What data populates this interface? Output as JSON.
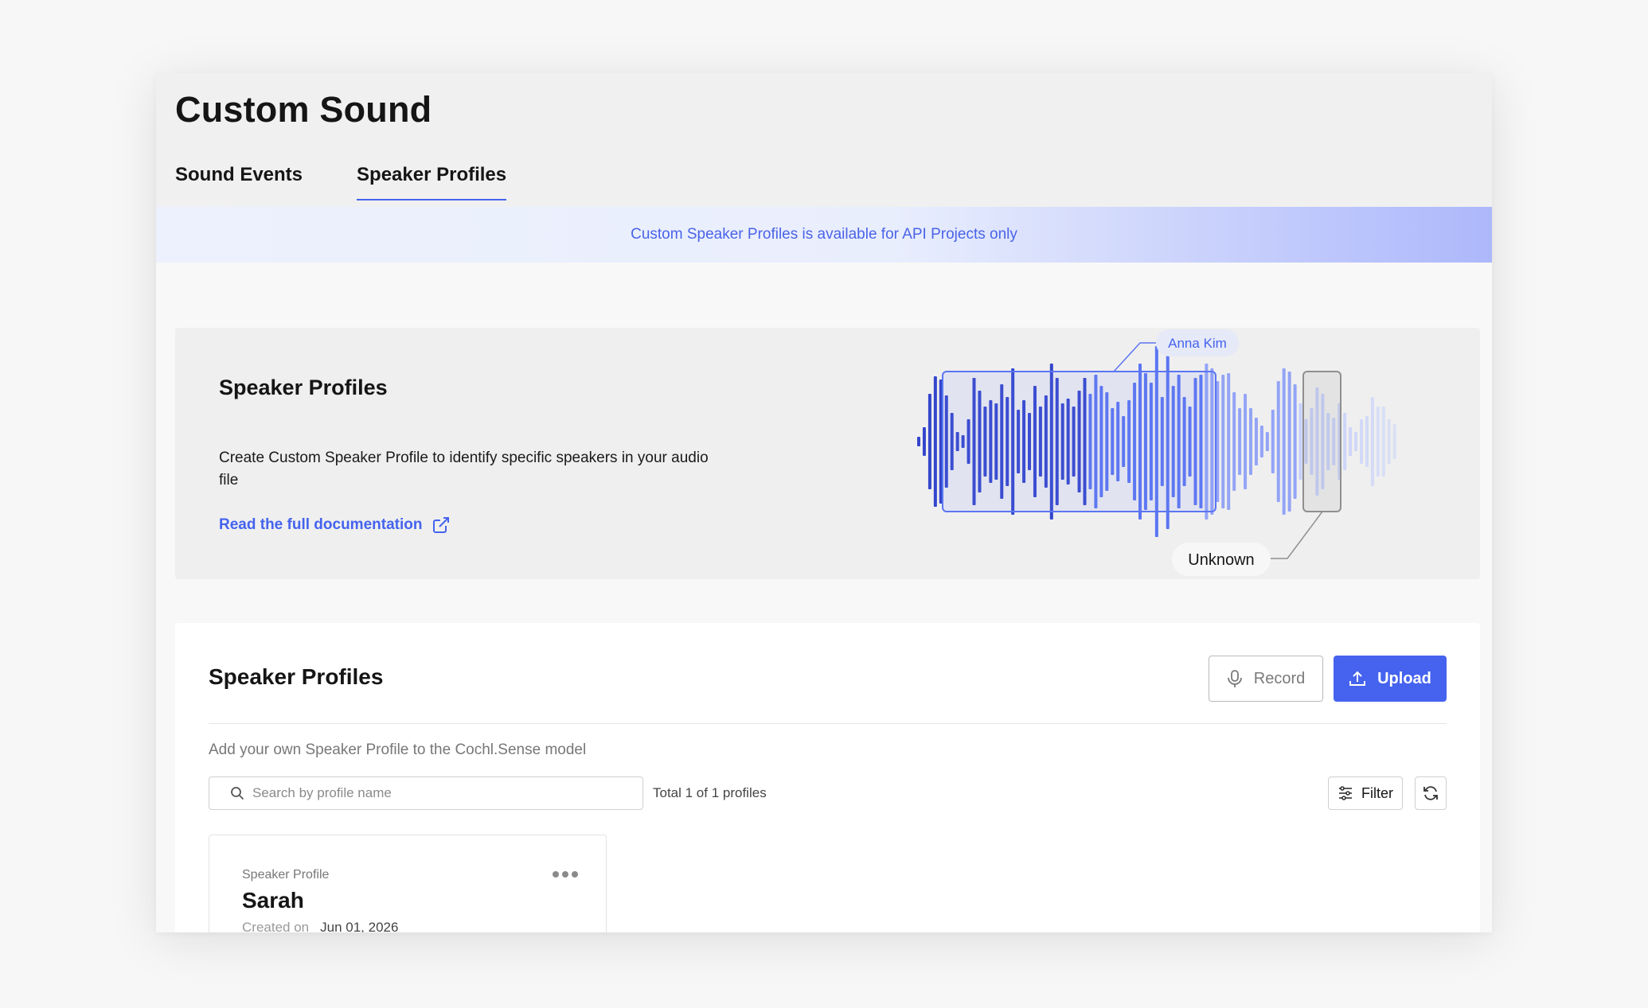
{
  "page": {
    "title": "Custom Sound",
    "tabs": [
      {
        "label": "Sound Events",
        "active": false
      },
      {
        "label": "Speaker Profiles",
        "active": true
      }
    ]
  },
  "banner": {
    "text": "Custom Speaker Profiles is available for API Projects only"
  },
  "hero": {
    "title": "Speaker Profiles",
    "description": "Create Custom Speaker Profile to identify specific speakers in your audio file",
    "link_label": "Read the full documentation",
    "illustration": {
      "speaker_tag": "Anna Kim",
      "unknown_tag": "Unknown"
    }
  },
  "profiles_section": {
    "title": "Speaker Profiles",
    "record_label": "Record",
    "upload_label": "Upload",
    "subtitle": "Add your own Speaker Profile to the Cochl.Sense model",
    "search_placeholder": "Search by profile name",
    "total_text": "Total 1 of 1 profiles",
    "filter_label": "Filter",
    "profiles": [
      {
        "type_label": "Speaker Profile",
        "name": "Sarah",
        "created_label": "Created on",
        "created_date": "Jun 01, 2026"
      }
    ]
  },
  "colors": {
    "accent": "#4563ee",
    "banner_text": "#4a63e8",
    "wave_dark": "#2d3fbf",
    "wave_light": "#9aa9f7"
  },
  "icons": [
    "external-link-icon",
    "microphone-icon",
    "upload-icon",
    "search-icon",
    "filter-icon",
    "refresh-icon",
    "more-options-icon"
  ]
}
